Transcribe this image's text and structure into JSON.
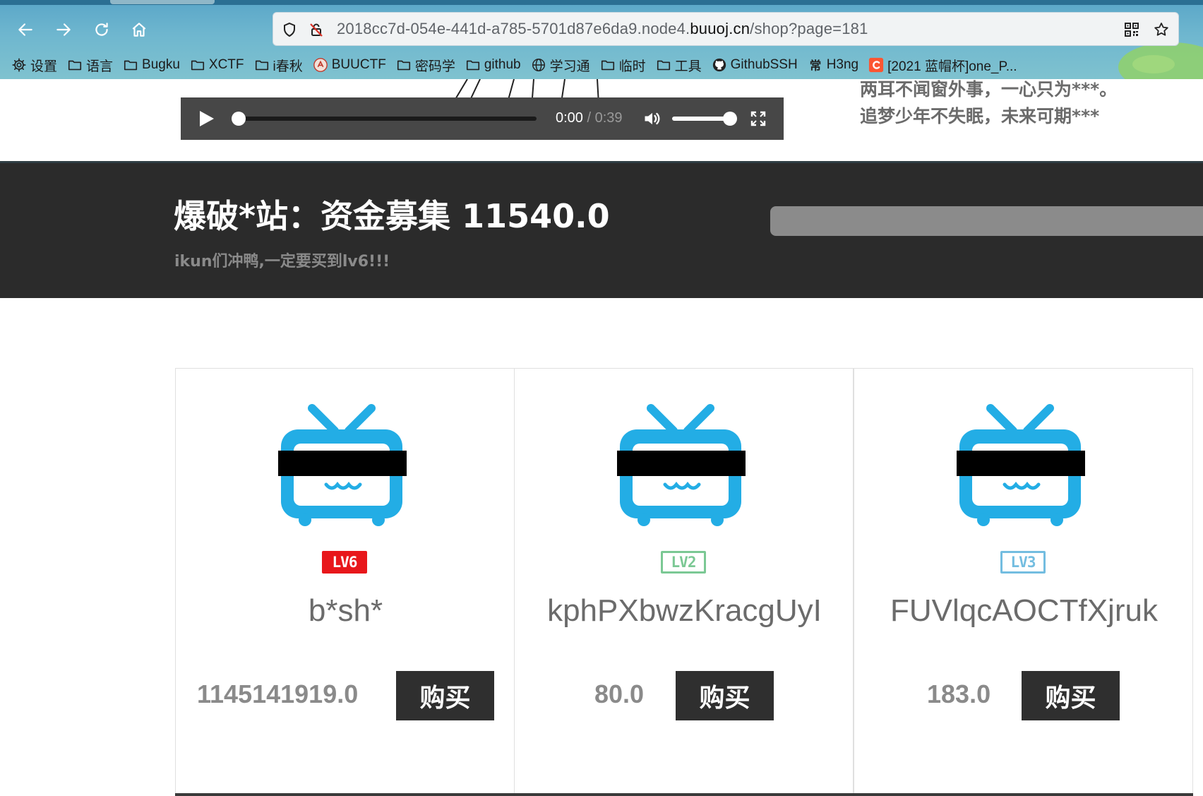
{
  "browser": {
    "url_prefix": "2018cc7d-054e-441d-a785-5701d87e6da9.node4.",
    "url_domain": "buuoj.cn",
    "url_path": "/shop?page=181",
    "bookmarks": [
      {
        "label": "设置",
        "icon": "gear-icon"
      },
      {
        "label": "语言",
        "icon": "folder-icon"
      },
      {
        "label": "Bugku",
        "icon": "folder-icon"
      },
      {
        "label": "XCTF",
        "icon": "folder-icon"
      },
      {
        "label": "i春秋",
        "icon": "folder-icon"
      },
      {
        "label": "BUUCTF",
        "icon": "buuctf-logo-icon"
      },
      {
        "label": "密码学",
        "icon": "folder-icon"
      },
      {
        "label": "github",
        "icon": "folder-icon"
      },
      {
        "label": "学习通",
        "icon": "globe-icon"
      },
      {
        "label": "临时",
        "icon": "folder-icon"
      },
      {
        "label": "工具",
        "icon": "folder-icon"
      },
      {
        "label": "GithubSSH",
        "icon": "github-icon"
      },
      {
        "label": "H3ng",
        "icon": "h3ng-icon"
      },
      {
        "label": "[2021 蓝帽杯]one_P...",
        "icon": "csdn-icon"
      }
    ]
  },
  "player": {
    "current_time": "0:00",
    "separator": " / ",
    "duration": "0:39",
    "progress": 0,
    "volume": 1.0
  },
  "lyrics": {
    "line1": "两耳不闻窗外事，一心只为***。",
    "line2": "追梦少年不失眠，未来可期***"
  },
  "banner": {
    "title": "爆破*站：资金募集 11540.0",
    "subtitle": "ikun们冲鸭,一定要买到lv6!!!"
  },
  "products": [
    {
      "level": "LV6",
      "name": "b*sh*",
      "price": "1145141919.0",
      "buy_label": "购买"
    },
    {
      "level": "LV2",
      "name": "kphPXbwzKracgUyI",
      "price": "80.0",
      "buy_label": "购买"
    },
    {
      "level": "LV3",
      "name": "FUVlqcAOCTfXjruk",
      "price": "183.0",
      "buy_label": "购买"
    }
  ],
  "colors": {
    "banner_bg": "#2b2b2b",
    "tv_blue": "#23ade5",
    "lv6": "#e8171b",
    "lv2": "#7bc894",
    "lv3": "#73bde0",
    "buy_button": "#2f2f2f"
  }
}
